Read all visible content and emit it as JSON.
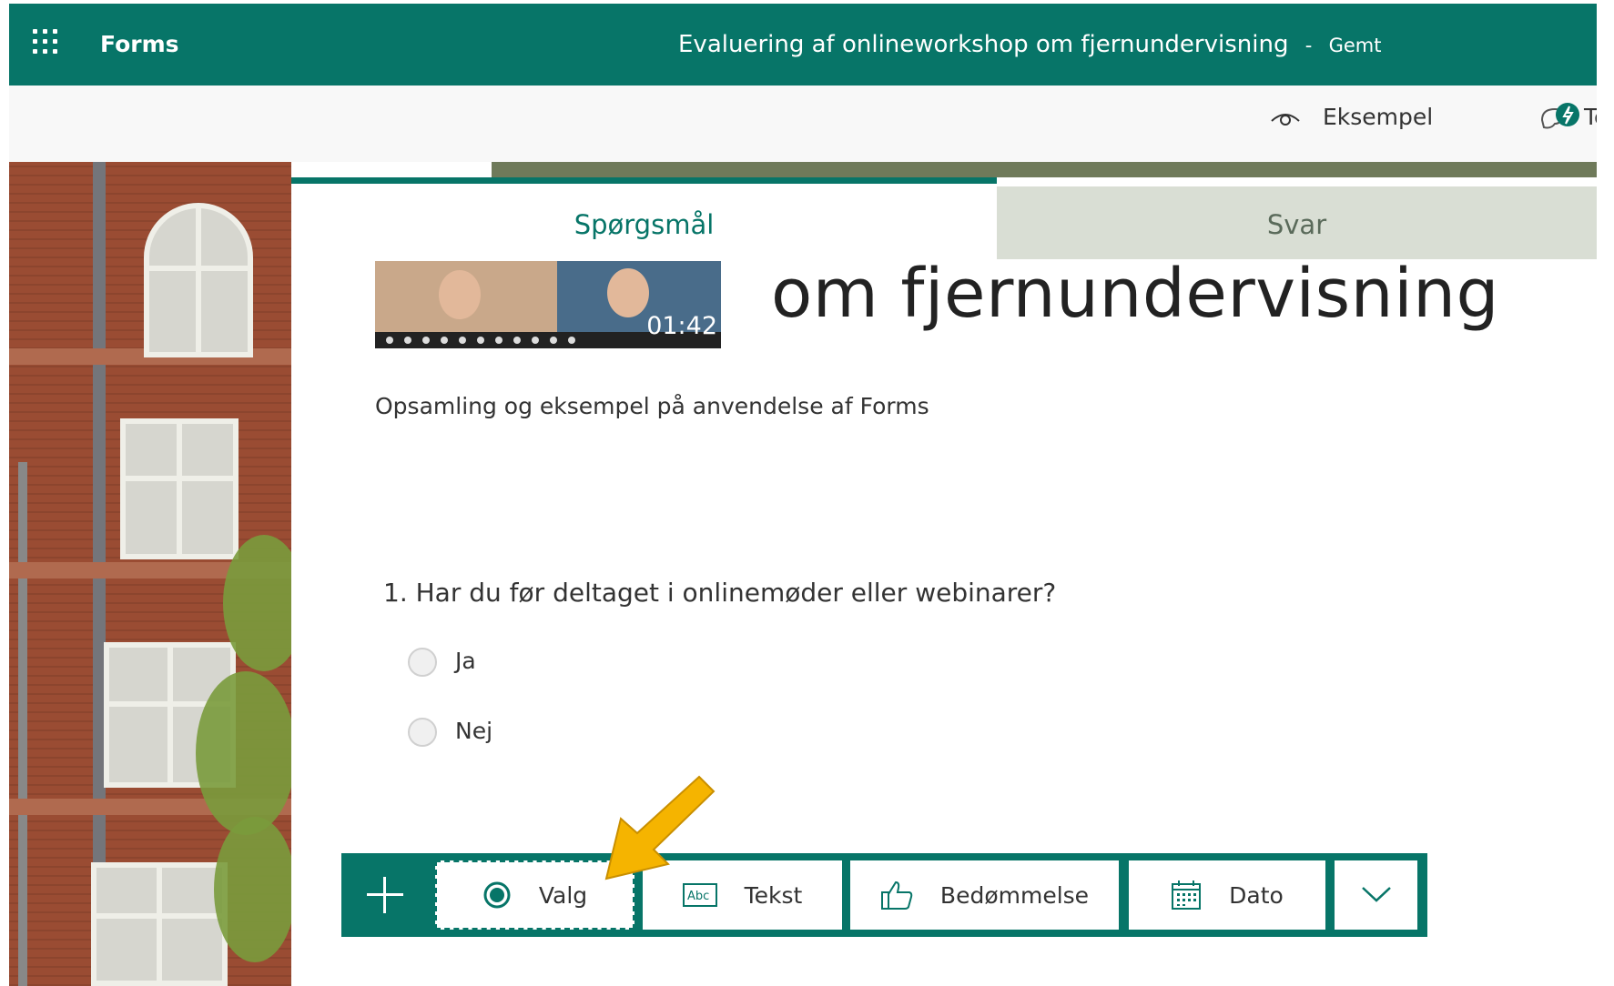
{
  "header": {
    "app_name": "Forms",
    "document_title": "Evaluering af onlineworkshop om fjernundervisning",
    "separator": "-",
    "save_status": "Gemt",
    "accent_color": "#077568"
  },
  "commands": {
    "preview_label": "Eksempel",
    "theme_label": "Te"
  },
  "tabs": [
    {
      "label": "Spørgsmål",
      "active": true
    },
    {
      "label": "Svar",
      "active": false
    }
  ],
  "video": {
    "duration": "01:42"
  },
  "form": {
    "title": "om fjernundervisning",
    "description": "Opsamling og eksempel på anvendelse af Forms"
  },
  "question": {
    "number": "1.",
    "text": "Har du før deltaget i onlinemøder eller webinarer?",
    "options": [
      "Ja",
      "Nej"
    ]
  },
  "add_toolbar": {
    "items": [
      {
        "label": "Valg",
        "icon": "radio-choice-icon",
        "selected": true
      },
      {
        "label": "Tekst",
        "icon": "text-abc-icon"
      },
      {
        "label": "Bedømmelse",
        "icon": "thumbs-up-icon"
      },
      {
        "label": "Dato",
        "icon": "calendar-icon"
      }
    ],
    "more_icon": "chevron-down-icon",
    "add_icon": "plus-icon"
  },
  "annotation": {
    "icon": "yellow-arrow-icon",
    "color": "#f5b400"
  }
}
